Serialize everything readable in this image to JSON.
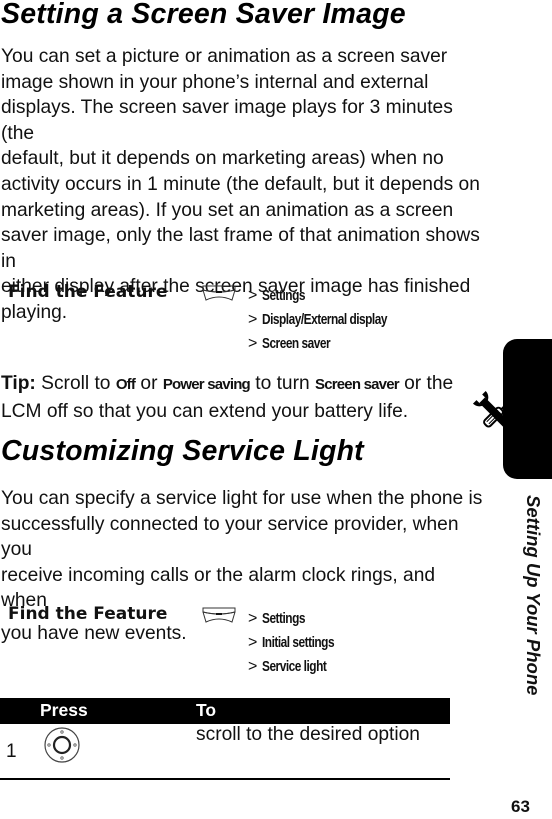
{
  "section1": {
    "title": "Setting a Screen Saver Image",
    "body_lines": [
      "You can set a picture or animation as a screen saver",
      "image shown in your phone’s internal and external",
      "displays. The screen saver image plays for 3 minutes (the",
      "default, but it depends on marketing areas) when no",
      "activity occurs in 1 minute (the default, but it depends on",
      "marketing areas). If you set an animation as a screen",
      "saver image, only the last frame of that animation shows in",
      "either display after the screen saver image has finished",
      "playing."
    ],
    "find_feature": {
      "label": "Find the Feature",
      "key_icon": "menu-key-icon",
      "path_sep": ">",
      "path": [
        "Settings",
        "Display/External display",
        "Screen saver"
      ]
    },
    "tip": {
      "label": "Tip:",
      "t1": " Scroll to ",
      "cmd1": "Off",
      "t2": " or ",
      "cmd2": "Power saving",
      "t3": " to turn ",
      "cmd3": "Screen saver",
      "t4": " or the",
      "line2": "LCM off so that you can extend your battery life."
    }
  },
  "section2": {
    "title": "Customizing Service Light",
    "body_lines": [
      "You can specify a service light for use when the phone is",
      "successfully connected to your service provider, when you",
      "receive incoming calls or the alarm clock rings, and when",
      "you have new events."
    ],
    "find_feature": {
      "label": "Find the Feature",
      "key_icon": "menu-key-icon",
      "path_sep": ">",
      "path": [
        "Settings",
        "Initial settings",
        "Service light"
      ]
    },
    "table": {
      "headers": {
        "press": "Press",
        "to": "To"
      },
      "rows": [
        {
          "num": "1",
          "key_icon": "navigation-key-icon",
          "action": "scroll to the desired option"
        }
      ]
    }
  },
  "sidebar": {
    "chapter_title": "Setting Up Your Phone",
    "icon": "tools-icon"
  },
  "page_number": "63"
}
